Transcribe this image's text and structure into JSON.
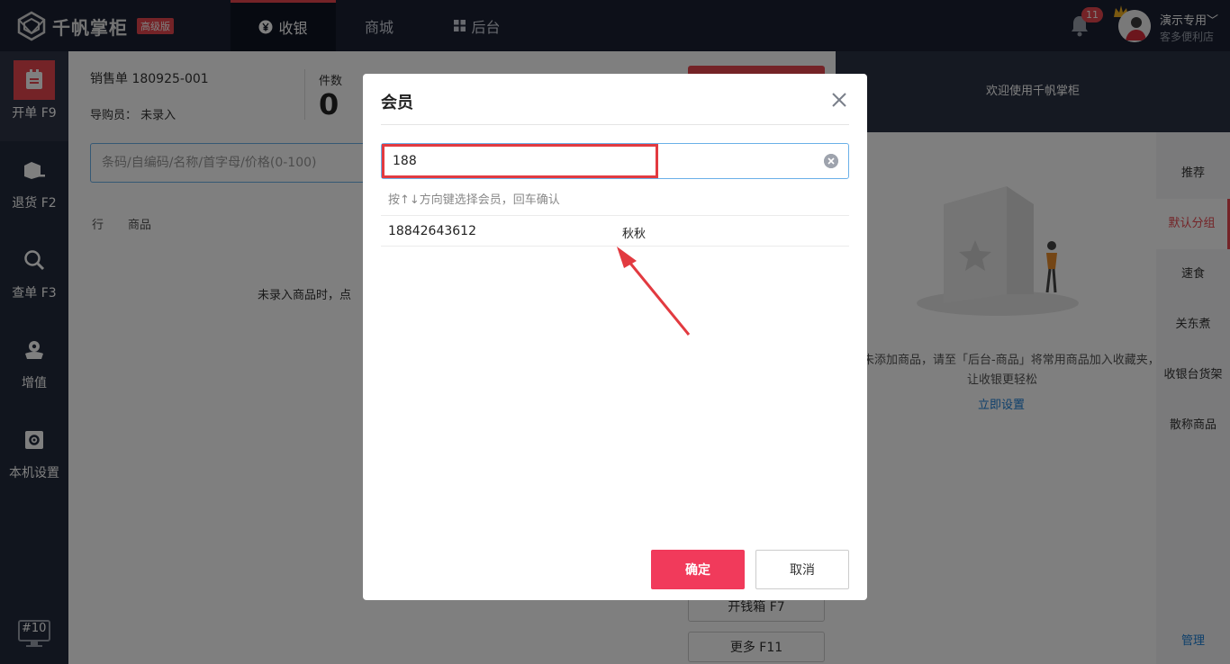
{
  "header": {
    "logo_text": "千帆掌柜",
    "edition": "高级版",
    "tabs": [
      {
        "label": "收银",
        "icon": "yen-icon"
      },
      {
        "label": "商城"
      },
      {
        "label": "后台",
        "icon": "grid-icon"
      }
    ],
    "notification_count": "11",
    "user": {
      "name": "演示专用",
      "store": "客多便利店"
    }
  },
  "sidebar": {
    "items": [
      {
        "label": "开单 F9",
        "icon": "receipt-icon"
      },
      {
        "label": "退货 F2",
        "icon": "return-box-icon"
      },
      {
        "label": "查单 F3",
        "icon": "search-icon"
      },
      {
        "label": "增值",
        "icon": "flower-icon"
      },
      {
        "label": "本机设置",
        "icon": "gear-icon"
      }
    ],
    "terminal": "#10"
  },
  "main": {
    "order_no": "销售单 180925-001",
    "guide": "导购员： 未录入",
    "count_label": "件数",
    "count_value": "0",
    "barcode_placeholder": "条码/自编码/名称/首字母/价格(0-100)",
    "col_row": "行",
    "col_goods": "商品",
    "empty_tip": "未录入商品时，点",
    "open_drawer": "开钱箱 F7",
    "more": "更多 F11"
  },
  "right_panel": {
    "welcome": "欢迎使用千帆掌柜",
    "hint_line1": "未添加商品，请至「后台-商品」将常用商品加入收藏夹，",
    "hint_line2": "让收银更轻松",
    "setup_link": "立即设置",
    "categories": [
      "推荐",
      "默认分组",
      "速食",
      "关东煮",
      "收银台货架",
      "散称商品"
    ],
    "active_category": "默认分组",
    "manage": "管理"
  },
  "modal": {
    "title": "会员",
    "input_value": "188",
    "nav_hint": "按↑↓方向键选择会员，回车确认",
    "results": [
      {
        "phone": "18842643612",
        "name": "秋秋"
      }
    ],
    "confirm": "确定",
    "cancel": "取消"
  },
  "colors": {
    "brand_red": "#e8474f",
    "confirm_pink": "#f13a5b",
    "header_bg": "#1a2133",
    "sidebar_bg": "#232a3c",
    "input_border": "#6ab0e8",
    "link_blue": "#1a7fd6"
  }
}
